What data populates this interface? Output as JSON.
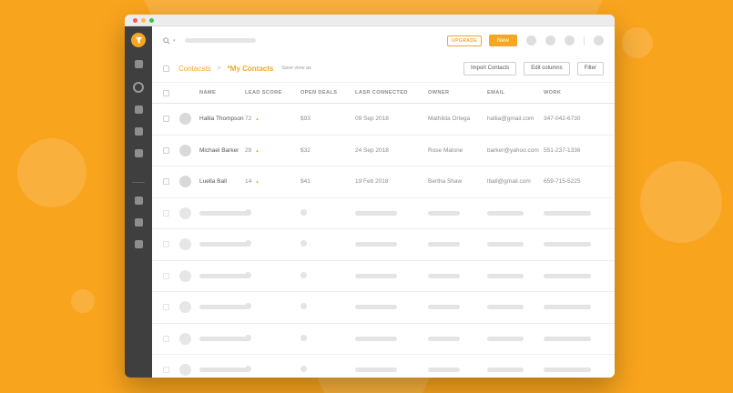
{
  "colors": {
    "accent": "#F5A623",
    "background": "#F9A41D",
    "sidebar": "#3F3F3F"
  },
  "window": {
    "traffic_lights": [
      "close",
      "minimize",
      "zoom"
    ]
  },
  "sidebar": {
    "logo_icon": "funnel-logo-icon",
    "nav_placeholder_count": 8
  },
  "topbar": {
    "search_icon": "search-icon",
    "upgrade_label": "UPGRADE",
    "new_label": "New",
    "icon_button_count": 4
  },
  "breadcrumb": {
    "section": "Contacsts",
    "separator": ">",
    "current": "*My Contacts",
    "save_view_label": "Save view as"
  },
  "actions": {
    "import_label": "Import Contacts",
    "edit_columns_label": "Edit columns",
    "filter_label": "Filter"
  },
  "table": {
    "columns": [
      "NAME",
      "LEAD SCORE",
      "OPEN DEALS",
      "LASR CONNECTED",
      "OWNER",
      "EMAIL",
      "WORK"
    ],
    "rows": [
      {
        "name": "Hallia Thompson",
        "lead_score": "72",
        "trend": "▲",
        "open_deals": "$93",
        "last_connected": "09 Sep 2018",
        "owner": "Mathilda Ortega",
        "email": "hallia@gmail.com",
        "work": "347-042-6730"
      },
      {
        "name": "Michael Barker",
        "lead_score": "29",
        "trend": "▲",
        "open_deals": "$32",
        "last_connected": "24 Sep 2018",
        "owner": "Rose Malone",
        "email": "barker@yahoo.com",
        "work": "551-237-1336"
      },
      {
        "name": "Luella Ball",
        "lead_score": "14",
        "trend": "▲",
        "open_deals": "$41",
        "last_connected": "19 Feb 2018",
        "owner": "Bertha Shaw",
        "email": "lball@gmail.com",
        "work": "659-715-5225"
      }
    ],
    "skeleton_row_count": 6
  }
}
